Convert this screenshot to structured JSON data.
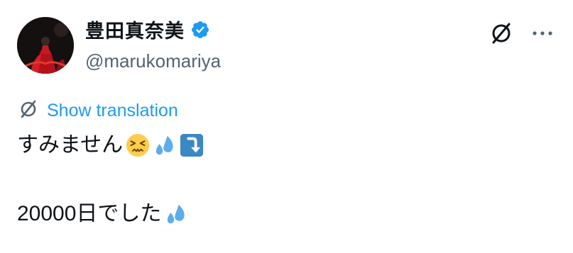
{
  "author": {
    "display_name": "豊田真奈美",
    "handle": "@marukomariya",
    "verified_icon": "verified-badge-icon"
  },
  "actions": {
    "translate_icon": "translate-icon",
    "more_icon": "more-icon"
  },
  "translation": {
    "label": "Show translation"
  },
  "tweet": {
    "line1_text": "すみません",
    "line1_emojis": [
      "persevering-face-emoji",
      "sweat-droplets-emoji",
      "down-arrow-emoji"
    ],
    "line2_text": "20000日でした",
    "line2_emojis": [
      "sweat-droplets-emoji"
    ]
  },
  "colors": {
    "accent": "#1d9bf0",
    "text": "#0f1419",
    "secondary": "#536471"
  }
}
